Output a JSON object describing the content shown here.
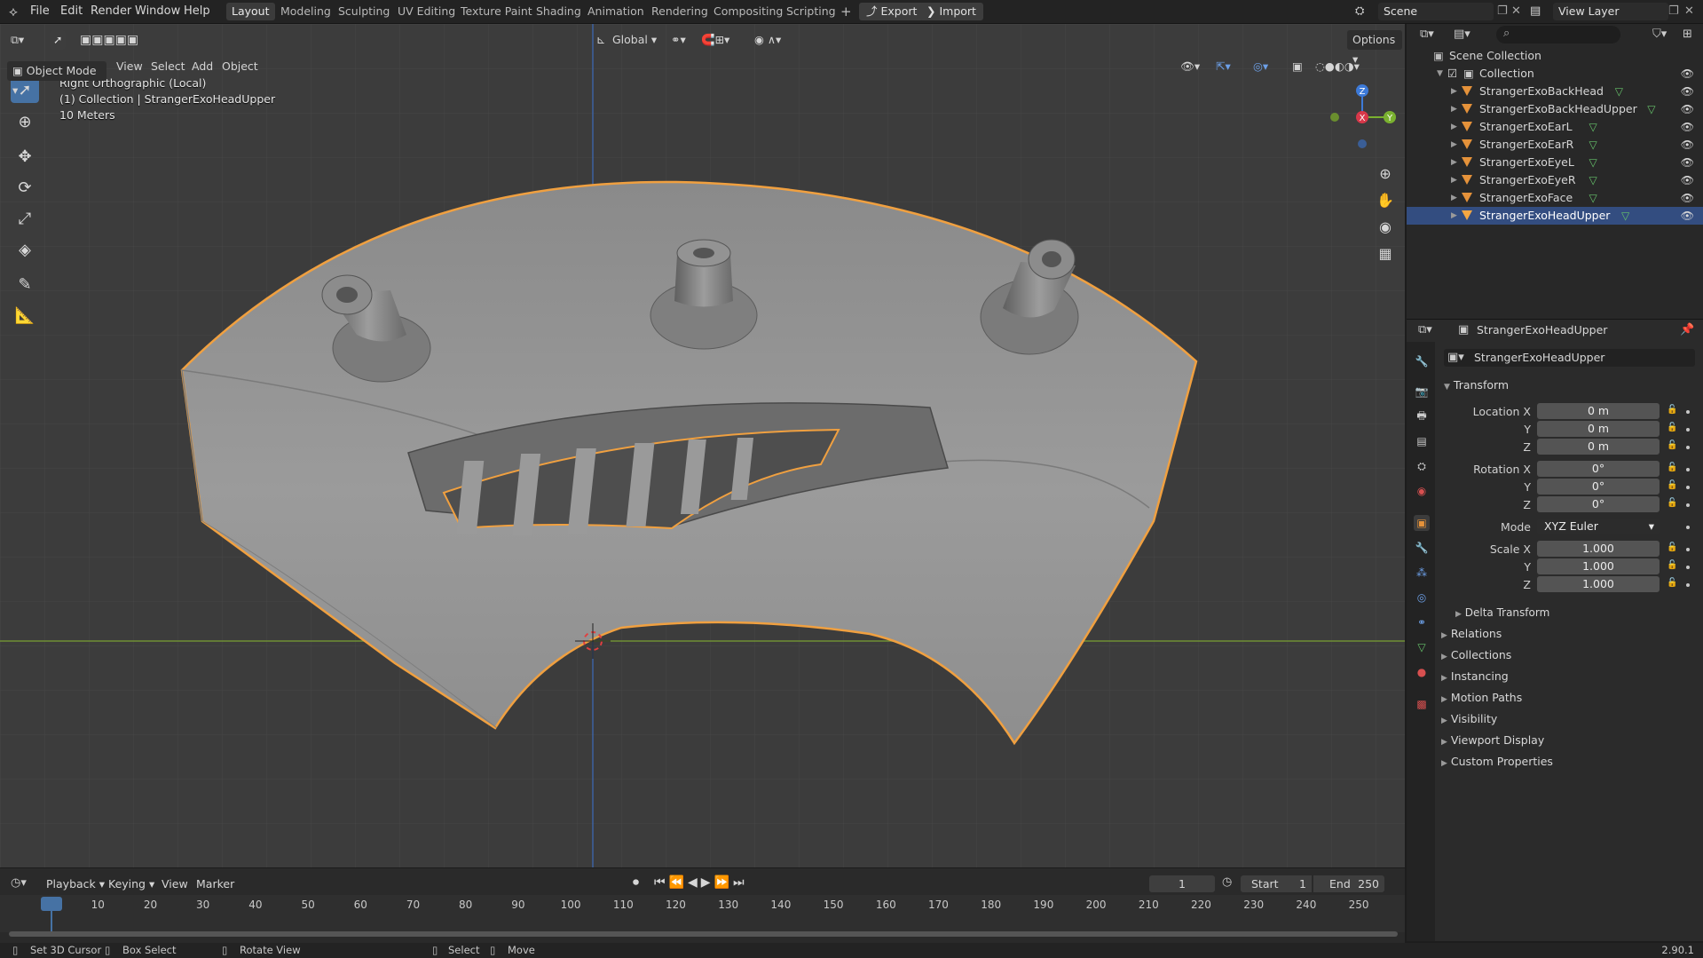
{
  "menu": {
    "items": [
      "File",
      "Edit",
      "Render",
      "Window",
      "Help"
    ]
  },
  "workspaces": {
    "tabs": [
      "Layout",
      "Modeling",
      "Sculpting",
      "UV Editing",
      "Texture Paint",
      "Shading",
      "Animation",
      "Rendering",
      "Compositing",
      "Scripting"
    ],
    "active": "Layout",
    "export_label": "Export",
    "import_label": "Import"
  },
  "scene": {
    "name": "Scene",
    "view_layer": "View Layer"
  },
  "viewport_header": {
    "mode": "Object Mode",
    "menus": [
      "View",
      "Select",
      "Add",
      "Object"
    ],
    "transform_orientation": "Global",
    "options_label": "Options"
  },
  "viewport_overlay": {
    "view_name": "Right Orthographic (Local)",
    "collection_info": "(1) Collection | StrangerExoHeadUpper",
    "scale": "10 Meters"
  },
  "gizmo": {
    "z": "Z",
    "y": "Y",
    "x": "X"
  },
  "outliner": {
    "root": "Scene Collection",
    "collection": "Collection",
    "objects": [
      {
        "name": "StrangerExoBackHead",
        "selected": false
      },
      {
        "name": "StrangerExoBackHeadUpper",
        "selected": false
      },
      {
        "name": "StrangerExoEarL",
        "selected": false
      },
      {
        "name": "StrangerExoEarR",
        "selected": false
      },
      {
        "name": "StrangerExoEyeL",
        "selected": false
      },
      {
        "name": "StrangerExoEyeR",
        "selected": false
      },
      {
        "name": "StrangerExoFace",
        "selected": false
      },
      {
        "name": "StrangerExoHeadUpper",
        "selected": true
      }
    ]
  },
  "properties": {
    "object_name": "StrangerExoHeadUpper",
    "data_name": "StrangerExoHeadUpper",
    "transform_label": "Transform",
    "location": {
      "label": "Location X",
      "x": "0 m",
      "y": "0 m",
      "z": "0 m"
    },
    "rotation": {
      "label": "Rotation X",
      "x": "0°",
      "y": "0°",
      "z": "0°"
    },
    "mode_label": "Mode",
    "mode_value": "XYZ Euler",
    "scale": {
      "label": "Scale X",
      "x": "1.000",
      "y": "1.000",
      "z": "1.000"
    },
    "axis_y": "Y",
    "axis_z": "Z",
    "delta_transform": "Delta Transform",
    "sections": [
      "Relations",
      "Collections",
      "Instancing",
      "Motion Paths",
      "Visibility",
      "Viewport Display",
      "Custom Properties"
    ]
  },
  "timeline": {
    "menus": [
      "Playback",
      "Keying",
      "View",
      "Marker"
    ],
    "current_frame": "1",
    "start_label": "Start",
    "start": "1",
    "end_label": "End",
    "end": "250",
    "ticks": [
      "1",
      "10",
      "20",
      "30",
      "40",
      "50",
      "60",
      "70",
      "80",
      "90",
      "100",
      "110",
      "120",
      "130",
      "140",
      "150",
      "160",
      "170",
      "180",
      "190",
      "200",
      "210",
      "220",
      "230",
      "240",
      "250"
    ]
  },
  "statusbar": {
    "items": [
      "Set 3D Cursor",
      "Box Select",
      "Rotate View",
      "Select",
      "Move"
    ],
    "version": "2.90.1"
  }
}
